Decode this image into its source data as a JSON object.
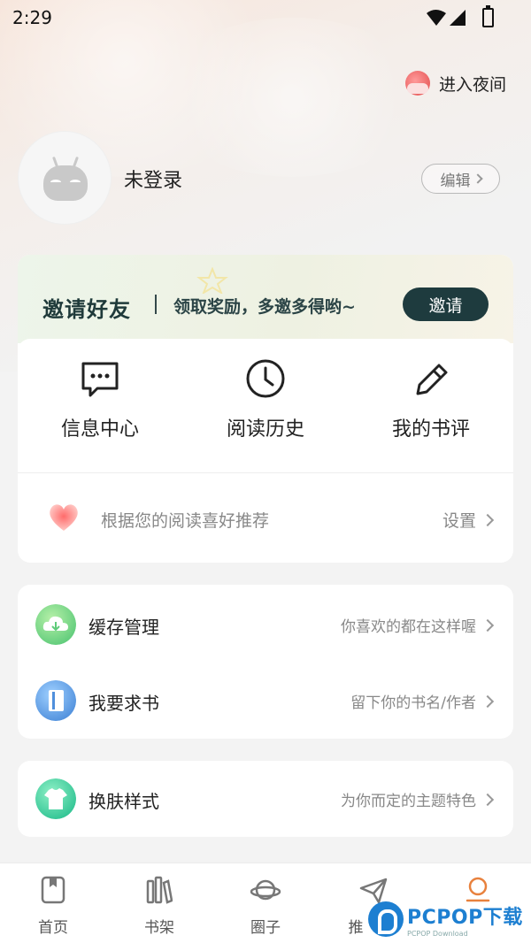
{
  "status_bar": {
    "time": "2:29"
  },
  "night_mode": {
    "label": "进入夜间",
    "icon": "cloud-night-icon"
  },
  "profile": {
    "username": "未登录",
    "edit_label": "编辑"
  },
  "invite": {
    "title": "邀请好友",
    "subtitle": "领取奖励，多邀多得哟~",
    "button": "邀请"
  },
  "quick_actions": [
    {
      "label": "信息中心",
      "icon": "message-icon"
    },
    {
      "label": "阅读历史",
      "icon": "clock-icon"
    },
    {
      "label": "我的书评",
      "icon": "pencil-icon"
    }
  ],
  "recommend": {
    "text": "根据您的阅读喜好推荐",
    "action": "设置",
    "icon": "heart-icon"
  },
  "menu_group1": [
    {
      "label": "缓存管理",
      "hint": "你喜欢的都在这样喔",
      "icon": "cloud-download-icon",
      "color": "#7dd88a"
    },
    {
      "label": "我要求书",
      "hint": "留下你的书名/作者",
      "icon": "book-icon",
      "color": "#5d9fe6"
    }
  ],
  "menu_group2": [
    {
      "label": "换肤样式",
      "hint": "为你而定的主题特色",
      "icon": "shirt-icon",
      "color": "#3fcf9e"
    }
  ],
  "tabs": [
    {
      "label": "首页",
      "icon": "book-home-icon"
    },
    {
      "label": "书架",
      "icon": "bookshelf-icon"
    },
    {
      "label": "圈子",
      "icon": "planet-icon"
    },
    {
      "label": "推",
      "icon": "send-icon"
    },
    {
      "label": "",
      "icon": "profile-icon"
    }
  ],
  "watermark": {
    "main": "PCPOP下载",
    "sub": "PCPOP Download"
  }
}
